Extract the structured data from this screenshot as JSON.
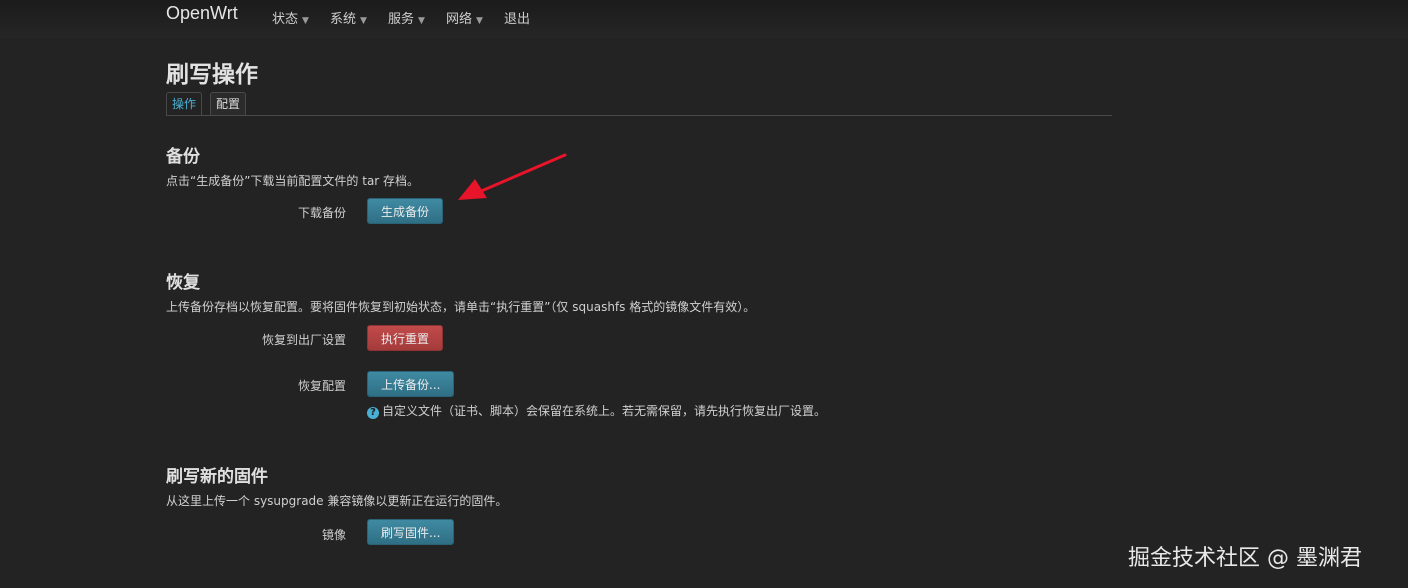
{
  "brand": "OpenWrt",
  "nav": [
    "状态",
    "系统",
    "服务",
    "网络",
    "退出"
  ],
  "page_title": "刷写操作",
  "tabs": [
    "操作",
    "配置"
  ],
  "backup": {
    "title": "备份",
    "desc": "点击“生成备份”下载当前配置文件的 tar 存档。",
    "download_label": "下载备份",
    "generate_button": "生成备份"
  },
  "restore": {
    "title": "恢复",
    "desc": "上传备份存档以恢复配置。要将固件恢复到初始状态，请单击“执行重置”（仅 squashfs 格式的镜像文件有效）。",
    "factory_label": "恢复到出厂设置",
    "reset_button": "执行重置",
    "restore_label": "恢复配置",
    "upload_button": "上传备份...",
    "hint": "自定义文件（证书、脚本）会保留在系统上。若无需保留，请先执行恢复出厂设置。"
  },
  "flash": {
    "title": "刷写新的固件",
    "desc": "从这里上传一个 sysupgrade 兼容镜像以更新正在运行的固件。",
    "image_label": "镜像",
    "flash_button": "刷写固件..."
  },
  "watermark": "掘金技术社区 @ 墨渊君",
  "colors": {
    "accent": "#4ab0d3",
    "primary_button": "#3a7f96",
    "danger_button": "#b54343",
    "arrow": "#e8142a"
  }
}
